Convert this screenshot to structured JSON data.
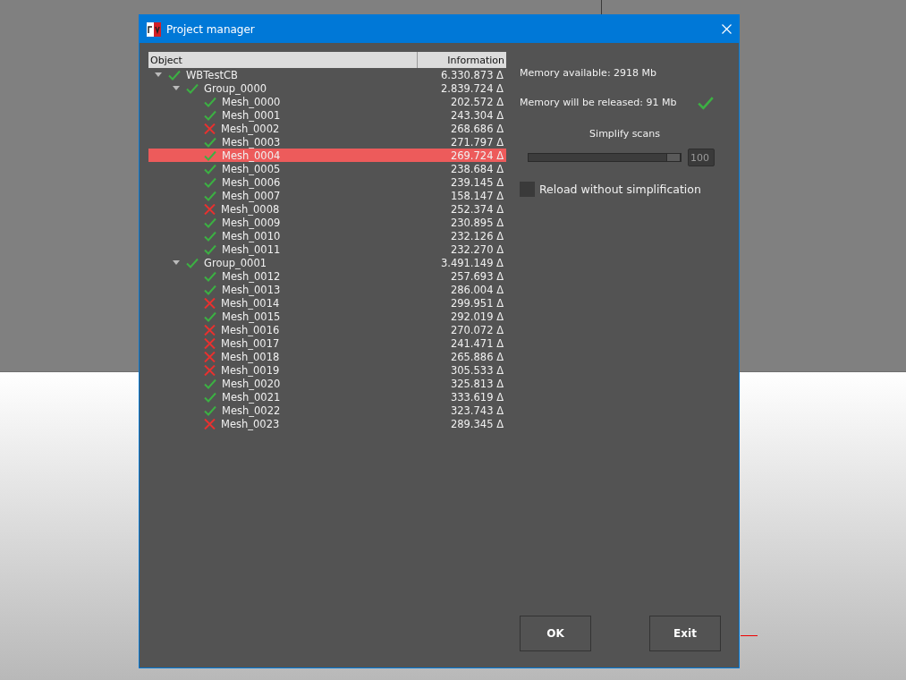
{
  "window": {
    "title": "Project manager"
  },
  "tree": {
    "columns": [
      "Object",
      "Information"
    ],
    "items": [
      {
        "name": "WBTestCB",
        "info": "6.330.873 Δ",
        "ok": true,
        "expanded": true,
        "selected": false,
        "children": [
          {
            "name": "Group_0000",
            "info": "2.839.724 Δ",
            "ok": true,
            "expanded": true,
            "selected": false,
            "children": [
              {
                "name": "Mesh_0000",
                "info": "202.572 Δ",
                "ok": true,
                "selected": false
              },
              {
                "name": "Mesh_0001",
                "info": "243.304 Δ",
                "ok": true,
                "selected": false
              },
              {
                "name": "Mesh_0002",
                "info": "268.686 Δ",
                "ok": false,
                "selected": false
              },
              {
                "name": "Mesh_0003",
                "info": "271.797 Δ",
                "ok": true,
                "selected": false
              },
              {
                "name": "Mesh_0004",
                "info": "269.724 Δ",
                "ok": true,
                "selected": true
              },
              {
                "name": "Mesh_0005",
                "info": "238.684 Δ",
                "ok": true,
                "selected": false
              },
              {
                "name": "Mesh_0006",
                "info": "239.145 Δ",
                "ok": true,
                "selected": false
              },
              {
                "name": "Mesh_0007",
                "info": "158.147 Δ",
                "ok": true,
                "selected": false
              },
              {
                "name": "Mesh_0008",
                "info": "252.374 Δ",
                "ok": false,
                "selected": false
              },
              {
                "name": "Mesh_0009",
                "info": "230.895 Δ",
                "ok": true,
                "selected": false
              },
              {
                "name": "Mesh_0010",
                "info": "232.126 Δ",
                "ok": true,
                "selected": false
              },
              {
                "name": "Mesh_0011",
                "info": "232.270 Δ",
                "ok": true,
                "selected": false
              }
            ]
          },
          {
            "name": "Group_0001",
            "info": "3.491.149 Δ",
            "ok": true,
            "expanded": true,
            "selected": false,
            "children": [
              {
                "name": "Mesh_0012",
                "info": "257.693 Δ",
                "ok": true,
                "selected": false
              },
              {
                "name": "Mesh_0013",
                "info": "286.004 Δ",
                "ok": true,
                "selected": false
              },
              {
                "name": "Mesh_0014",
                "info": "299.951 Δ",
                "ok": false,
                "selected": false
              },
              {
                "name": "Mesh_0015",
                "info": "292.019 Δ",
                "ok": true,
                "selected": false
              },
              {
                "name": "Mesh_0016",
                "info": "270.072 Δ",
                "ok": false,
                "selected": false
              },
              {
                "name": "Mesh_0017",
                "info": "241.471 Δ",
                "ok": false,
                "selected": false
              },
              {
                "name": "Mesh_0018",
                "info": "265.886 Δ",
                "ok": false,
                "selected": false
              },
              {
                "name": "Mesh_0019",
                "info": "305.533 Δ",
                "ok": false,
                "selected": false
              },
              {
                "name": "Mesh_0020",
                "info": "325.813 Δ",
                "ok": true,
                "selected": false
              },
              {
                "name": "Mesh_0021",
                "info": "333.619 Δ",
                "ok": true,
                "selected": false
              },
              {
                "name": "Mesh_0022",
                "info": "323.743 Δ",
                "ok": true,
                "selected": false
              },
              {
                "name": "Mesh_0023",
                "info": "289.345 Δ",
                "ok": false,
                "selected": false
              }
            ]
          }
        ]
      }
    ]
  },
  "memory_available": "Memory available: 2918 Mb",
  "memory_released": {
    "text": "Memory will be released: 91 Mb",
    "ok": true
  },
  "simplify": {
    "label": "Simplify scans",
    "level": 1,
    "value": "100"
  },
  "reload": {
    "label": "Reload without simplification",
    "checked": false
  },
  "buttons": [
    "OK",
    "Exit"
  ]
}
